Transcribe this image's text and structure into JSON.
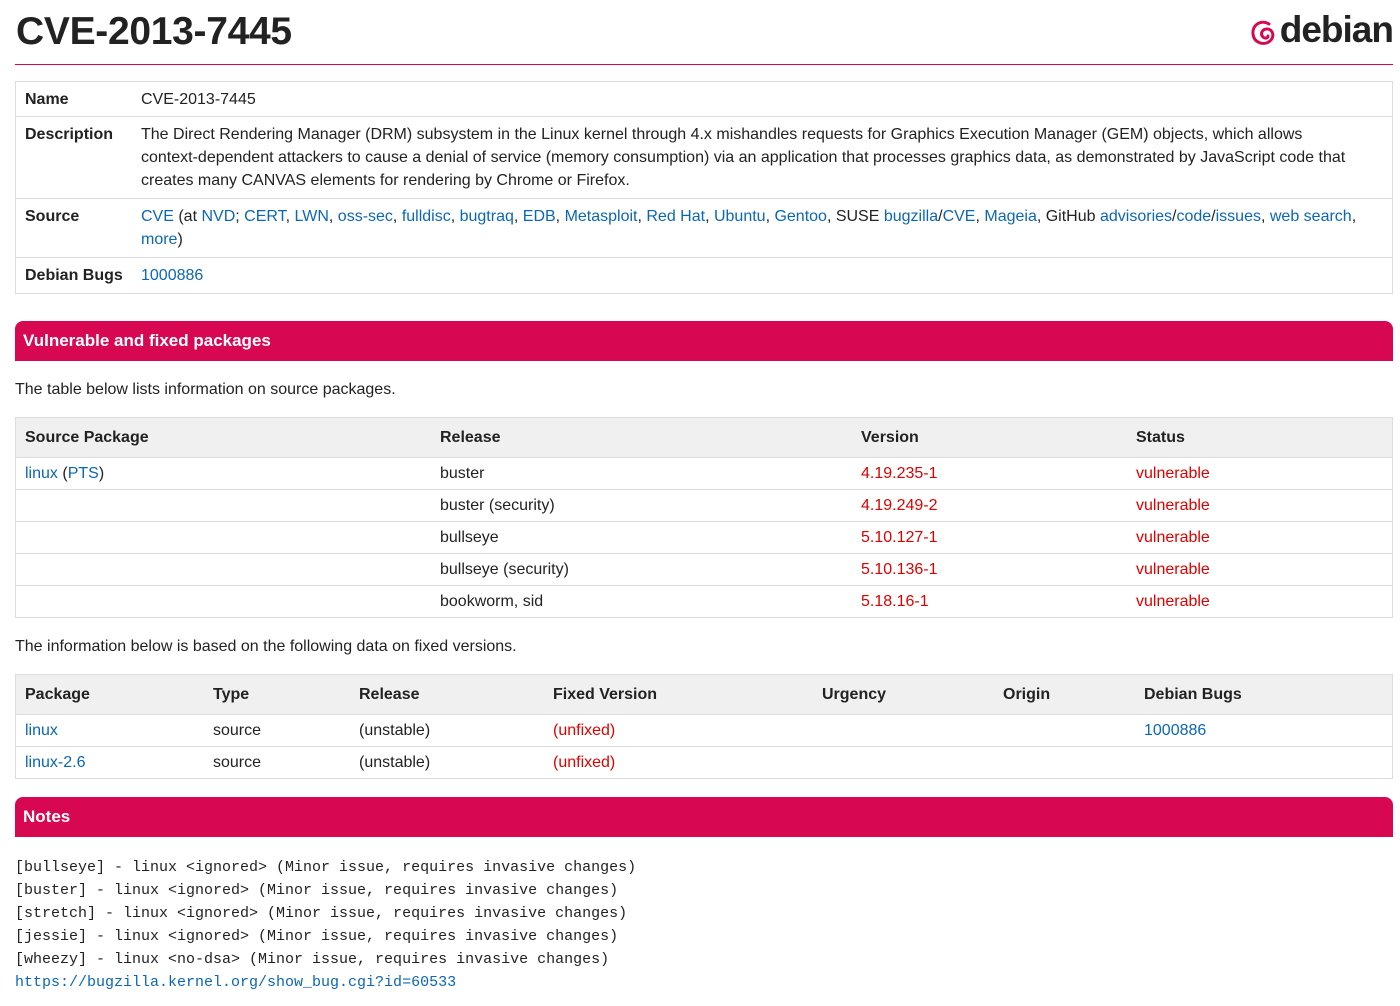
{
  "header": {
    "title": "CVE-2013-7445",
    "logo_text": "debian"
  },
  "info": {
    "name_label": "Name",
    "name_value": "CVE-2013-7445",
    "description_label": "Description",
    "description_value": "The Direct Rendering Manager (DRM) subsystem in the Linux kernel through 4.x mishandles requests for Graphics Execution Manager (GEM) objects, which allows context-dependent attackers to cause a denial of service (memory consumption) via an application that processes graphics data, as demonstrated by JavaScript code that creates many CANVAS elements for rendering by Chrome or Firefox.",
    "source_label": "Source",
    "source_links": {
      "cve": "CVE",
      "at": " (at ",
      "nvd": "NVD",
      "cert": "CERT",
      "lwn": "LWN",
      "oss_sec": "oss-sec",
      "fulldisc": "fulldisc",
      "bugtraq": "bugtraq",
      "edb": "EDB",
      "metasploit": "Metasploit",
      "redhat": "Red Hat",
      "ubuntu": "Ubuntu",
      "gentoo": "Gentoo",
      "suse": "SUSE ",
      "bugzilla": "bugzilla",
      "suse_cve": "CVE",
      "mageia": "Mageia",
      "github": "GitHub ",
      "advisories": "advisories",
      "code": "code",
      "issues": "issues",
      "web_search": "web search",
      "more": "more",
      "close": ")"
    },
    "bugs_label": "Debian Bugs",
    "bugs_value": "1000886"
  },
  "vuln_section": {
    "heading": "Vulnerable and fixed packages",
    "intro": "The table below lists information on source packages.",
    "columns": [
      "Source Package",
      "Release",
      "Version",
      "Status"
    ],
    "package": "linux",
    "pts": "PTS",
    "rows": [
      {
        "release": "buster",
        "version": "4.19.235-1",
        "status": "vulnerable"
      },
      {
        "release": "buster (security)",
        "version": "4.19.249-2",
        "status": "vulnerable"
      },
      {
        "release": "bullseye",
        "version": "5.10.127-1",
        "status": "vulnerable"
      },
      {
        "release": "bullseye (security)",
        "version": "5.10.136-1",
        "status": "vulnerable"
      },
      {
        "release": "bookworm, sid",
        "version": "5.18.16-1",
        "status": "vulnerable"
      }
    ]
  },
  "fixed_section": {
    "intro": "The information below is based on the following data on fixed versions.",
    "columns": [
      "Package",
      "Type",
      "Release",
      "Fixed Version",
      "Urgency",
      "Origin",
      "Debian Bugs"
    ],
    "rows": [
      {
        "package": "linux",
        "type": "source",
        "release": "(unstable)",
        "fixed": "(unfixed)",
        "urgency": "",
        "origin": "",
        "bugs": "1000886"
      },
      {
        "package": "linux-2.6",
        "type": "source",
        "release": "(unstable)",
        "fixed": "(unfixed)",
        "urgency": "",
        "origin": "",
        "bugs": ""
      }
    ]
  },
  "notes_section": {
    "heading": "Notes",
    "lines": [
      "[bullseye] - linux <ignored> (Minor issue, requires invasive changes)",
      "[buster] - linux <ignored> (Minor issue, requires invasive changes)",
      "[stretch] - linux <ignored> (Minor issue, requires invasive changes)",
      "[jessie] - linux <ignored> (Minor issue, requires invasive changes)",
      "[wheezy] - linux <no-dsa> (Minor issue, requires invasive changes)"
    ],
    "link": "https://bugzilla.kernel.org/show_bug.cgi?id=60533"
  },
  "colors": {
    "accent": "#d70751",
    "link": "#0b67b5",
    "vulnerable": "#e00000"
  }
}
